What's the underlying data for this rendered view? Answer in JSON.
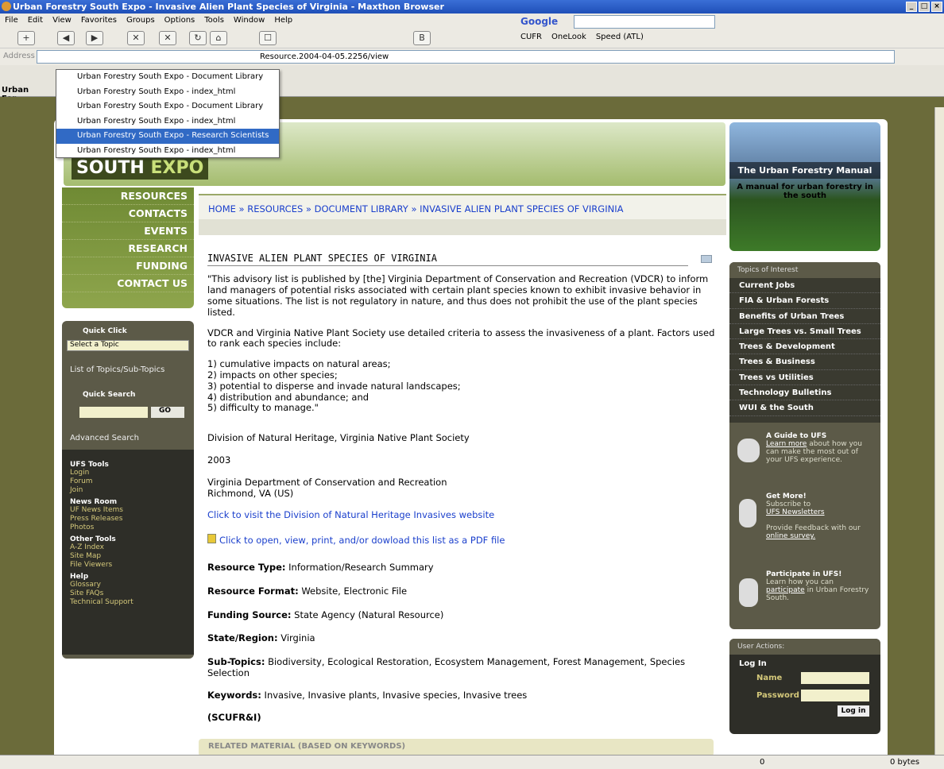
{
  "window": {
    "title": "Urban Forestry South Expo - Invasive Alien Plant Species of Virginia - Maxthon Browser"
  },
  "menu": [
    "File",
    "Edit",
    "View",
    "Favorites",
    "Groups",
    "Options",
    "Tools",
    "Window",
    "Help"
  ],
  "search": {
    "engine": "Google"
  },
  "links": [
    "CUFR",
    "OneLook",
    "Speed (ATL)"
  ],
  "address": {
    "label": "Address",
    "url": "Resource.2004-04-05.2256/view"
  },
  "tab": {
    "label": "Urban For"
  },
  "history_menu": [
    "Urban Forestry South Expo - Document Library",
    "Urban Forestry South Expo - index_html",
    "Urban Forestry South Expo - Document Library",
    "Urban Forestry South Expo - index_html",
    "Urban Forestry South Expo - Research Scientists",
    "Urban Forestry South Expo - index_html"
  ],
  "logo": {
    "a": "SOUTH",
    "b": "EXPO"
  },
  "manual": {
    "title": "The Urban Forestry Manual",
    "sub": "A manual for urban forestry in the south"
  },
  "nav": [
    "RESOURCES",
    "CONTACTS",
    "EVENTS",
    "RESEARCH",
    "FUNDING",
    "CONTACT US"
  ],
  "quick": {
    "click": "Quick Click",
    "select": "Select a Topic",
    "list": "List of Topics/Sub-Topics",
    "search": "Quick Search",
    "go": "GO",
    "adv": "Advanced Search",
    "tools_h": "UFS Tools",
    "tools": [
      "Login",
      "Forum",
      "Join"
    ],
    "news_h": "News Room",
    "news": [
      "UF News Items",
      "Press Releases",
      "Photos"
    ],
    "other_h": "Other Tools",
    "other": [
      "A-Z Index",
      "Site Map",
      "File Viewers"
    ],
    "help_h": "Help",
    "help": [
      "Glossary",
      "Site FAQs",
      "Technical Support"
    ]
  },
  "breadcrumb": "HOME » RESOURCES » DOCUMENT LIBRARY » INVASIVE ALIEN PLANT SPECIES OF VIRGINIA",
  "content": {
    "title": "INVASIVE ALIEN PLANT SPECIES OF VIRGINIA",
    "p1": "\"This advisory list is published by [the] Virginia Department of Conservation and Recreation (VDCR) to inform land managers of potential risks associated with certain plant species known to exhibit invasive behavior in some situations. The list is not regulatory in nature, and thus does not prohibit the use of the plant species listed.",
    "p2": "VDCR and Virginia Native Plant Society use detailed criteria to assess the invasiveness of a plant. Factors used to rank each species include:",
    "list": [
      "1) cumulative impacts on natural areas;",
      "2) impacts on other species;",
      "3) potential to disperse and invade natural landscapes;",
      "4) distribution and abundance; and",
      "5) difficulty to manage.\""
    ],
    "author": "Division of Natural Heritage, Virginia Native Plant Society",
    "year": "2003",
    "pub1": "Virginia Department of Conservation and Recreation",
    "pub2": "Richmond, VA (US)",
    "link1": "Click to visit the Division of Natural Heritage Invasives website",
    "link2": "Click to open, view, print, and/or dowload this list as a PDF file",
    "rt_l": "Resource Type:",
    "rt_v": "Information/Research Summary",
    "rf_l": "Resource Format:",
    "rf_v": "Website, Electronic File",
    "fs_l": "Funding Source:",
    "fs_v": "State Agency (Natural Resource)",
    "sr_l": "State/Region:",
    "sr_v": "Virginia",
    "st_l": "Sub-Topics:",
    "st_v": "Biodiversity, Ecological Restoration, Ecosystem Management, Forest Management, Species Selection",
    "kw_l": "Keywords:",
    "kw_v": "Invasive, Invasive plants, Invasive species, Invasive trees",
    "code": "(SCUFR&I)",
    "related": "RELATED MATERIAL (BASED ON KEYWORDS)"
  },
  "topics": {
    "header": "Topics of Interest",
    "items": [
      "Current Jobs",
      "FIA & Urban Forests",
      "Benefits of Urban Trees",
      "Large Trees vs. Small Trees",
      "Trees & Development",
      "Trees & Business",
      "Trees vs Utilities",
      "Technology Bulletins",
      "WUI & the South"
    ]
  },
  "promo": {
    "g_h": "A Guide to UFS",
    "g_link": "Learn more",
    "g_t": "about how you can make the most out of your UFS experience.",
    "m_h": "Get More!",
    "m_t": "Subscribe to",
    "m_link": "UFS Newsletters",
    "m_t2": "Provide Feedback with our",
    "m_link2": "online survey.",
    "p_h": "Participate in UFS!",
    "p_t": "Learn how you can",
    "p_link": "participate",
    "p_t2": "in Urban Forestry South."
  },
  "user": {
    "header": "User Actions:",
    "login": "Log In",
    "name": "Name",
    "password": "Password",
    "btn": "Log in"
  },
  "status": {
    "count": "0",
    "bytes": "0 bytes"
  }
}
